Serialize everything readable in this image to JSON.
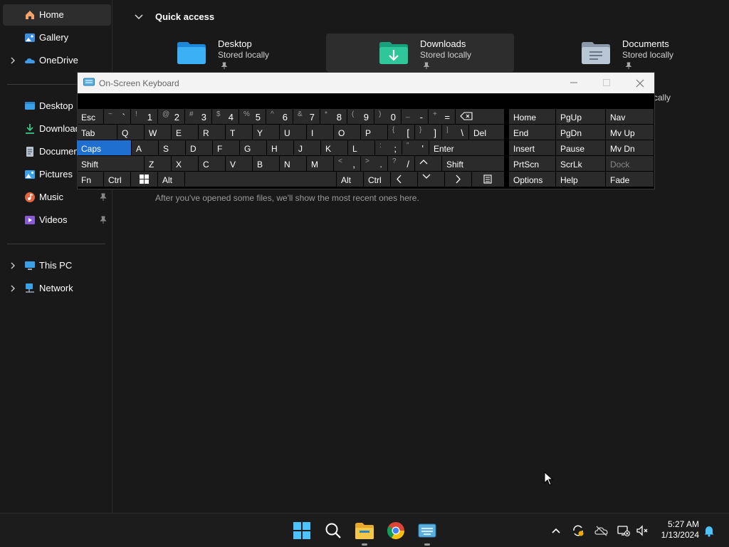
{
  "sidebar": {
    "items": [
      {
        "label": "Home",
        "icon": "home-icon",
        "active": true
      },
      {
        "label": "Gallery",
        "icon": "gallery-icon"
      },
      {
        "label": "OneDrive",
        "icon": "onedrive-icon",
        "expandable": true
      },
      {
        "label": "Desktop",
        "icon": "desktop-folder-icon"
      },
      {
        "label": "Downloads",
        "icon": "downloads-folder-icon"
      },
      {
        "label": "Documents",
        "icon": "documents-folder-icon"
      },
      {
        "label": "Pictures",
        "icon": "pictures-folder-icon"
      },
      {
        "label": "Music",
        "icon": "music-folder-icon",
        "pinned": true
      },
      {
        "label": "Videos",
        "icon": "videos-folder-icon",
        "pinned": true
      },
      {
        "label": "This PC",
        "icon": "this-pc-icon",
        "expandable": true
      },
      {
        "label": "Network",
        "icon": "network-icon",
        "expandable": true
      }
    ]
  },
  "main": {
    "quick_access_label": "Quick access",
    "tiles": [
      {
        "name": "Desktop",
        "sub": "Stored locally"
      },
      {
        "name": "Downloads",
        "sub": "Stored locally"
      },
      {
        "name": "Documents",
        "sub": "Stored locally"
      }
    ],
    "hidden_tile_sub_fragment": "cally",
    "recent_empty_message": "After you've opened some files, we'll show the most recent ones here."
  },
  "osk": {
    "title": "On-Screen Keyboard",
    "keys": {
      "esc": "Esc",
      "tab": "Tab",
      "caps": "Caps",
      "shift_l": "Shift",
      "fn": "Fn",
      "ctrl_l": "Ctrl",
      "alt_l": "Alt",
      "alt_r": "Alt",
      "ctrl_r": "Ctrl",
      "del": "Del",
      "enter": "Enter",
      "shift_r": "Shift",
      "num": [
        [
          "~",
          "`"
        ],
        [
          "!",
          "1"
        ],
        [
          "@",
          "2"
        ],
        [
          "#",
          "3"
        ],
        [
          "$",
          "4"
        ],
        [
          "%",
          "5"
        ],
        [
          "^",
          "6"
        ],
        [
          "&",
          "7"
        ],
        [
          "*",
          "8"
        ],
        [
          "(",
          "9"
        ],
        [
          ")",
          "0"
        ],
        [
          "_",
          "-"
        ],
        [
          "+",
          "="
        ]
      ],
      "row_q": [
        "Q",
        "W",
        "E",
        "R",
        "T",
        "Y",
        "U",
        "I",
        "O",
        "P"
      ],
      "row_q_sym": [
        [
          "{",
          "["
        ],
        [
          "}",
          "]"
        ],
        [
          "|",
          "\\"
        ]
      ],
      "row_a": [
        "A",
        "S",
        "D",
        "F",
        "G",
        "H",
        "J",
        "K",
        "L"
      ],
      "row_a_sym": [
        [
          ":",
          ";"
        ],
        [
          "\"",
          "'"
        ]
      ],
      "row_z": [
        "Z",
        "X",
        "C",
        "V",
        "B",
        "N",
        "M"
      ],
      "row_z_sym": [
        [
          "<",
          ","
        ],
        [
          ">",
          "."
        ],
        [
          "?",
          "/"
        ]
      ],
      "nav": [
        [
          "Home",
          "PgUp",
          "Nav"
        ],
        [
          "End",
          "PgDn",
          "Mv Up"
        ],
        [
          "Insert",
          "Pause",
          "Mv Dn"
        ],
        [
          "PrtScn",
          "ScrLk",
          "Dock"
        ],
        [
          "Options",
          "Help",
          "Fade"
        ]
      ]
    },
    "accent": "#1e6fd0"
  },
  "taskbar": {
    "apps": [
      "start-icon",
      "search-icon",
      "file-explorer-icon",
      "chrome-icon",
      "on-screen-keyboard-icon"
    ],
    "tray": [
      "chevron-up-icon",
      "sync-icon",
      "onedrive-offline-icon",
      "network-disconnected-icon",
      "speaker-muted-icon"
    ],
    "time": "5:27 AM",
    "date": "1/13/2024"
  }
}
